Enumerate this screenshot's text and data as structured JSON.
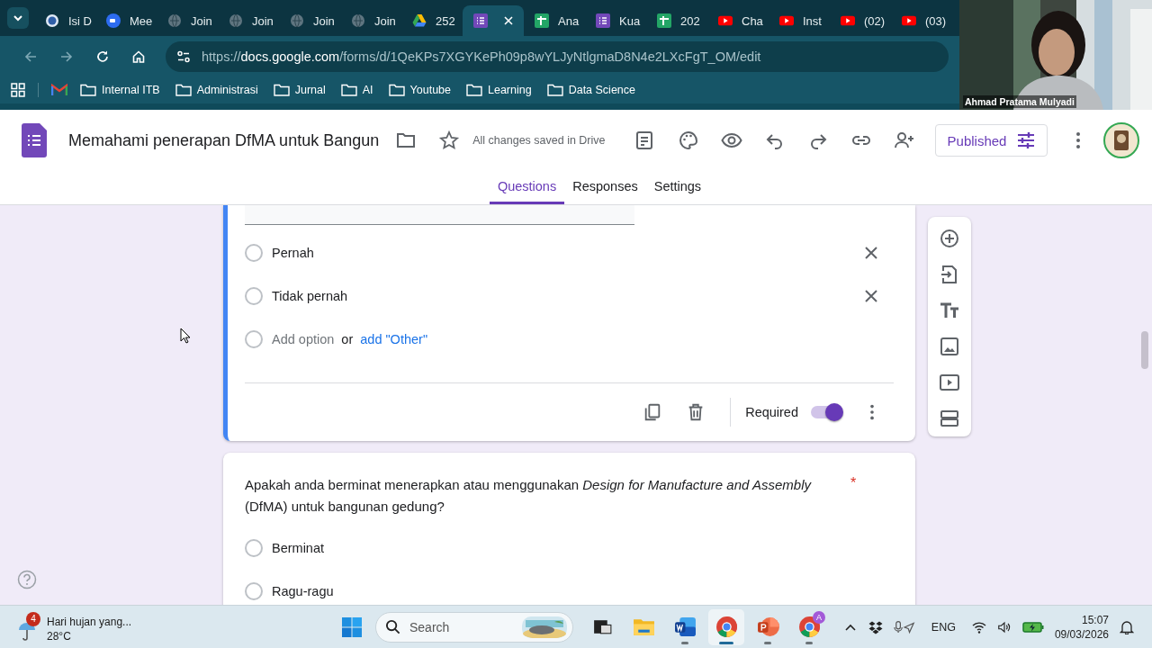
{
  "browser": {
    "tabs": [
      {
        "title": "Isi D",
        "kind": "portal",
        "selected": false
      },
      {
        "title": "Mee",
        "kind": "zoom",
        "selected": false
      },
      {
        "title": "Join",
        "kind": "site",
        "selected": false
      },
      {
        "title": "Join",
        "kind": "site",
        "selected": false
      },
      {
        "title": "Join",
        "kind": "site",
        "selected": false
      },
      {
        "title": "Join",
        "kind": "site",
        "selected": false
      },
      {
        "title": "252",
        "kind": "drive",
        "selected": false
      },
      {
        "kind": "forms",
        "selected": true
      },
      {
        "title": "Ana",
        "kind": "sheets",
        "selected": false
      },
      {
        "title": "Kua",
        "kind": "forms",
        "selected": false
      },
      {
        "title": "202",
        "kind": "sheets",
        "selected": false
      },
      {
        "title": "Cha",
        "kind": "youtube",
        "selected": false
      },
      {
        "title": "Inst",
        "kind": "youtube",
        "selected": false
      },
      {
        "title": "(02)",
        "kind": "youtube",
        "selected": false
      },
      {
        "title": "(03)",
        "kind": "youtube",
        "selected": false
      }
    ],
    "url_scheme": "https://",
    "url_host": "docs.google.com",
    "url_path": "/forms/d/1QeKPs7XGYKePh09p8wYLJyNtlgmaD8N4e2LXcFgT_OM/edit",
    "bookmarks": [
      "Internal ITB",
      "Administrasi",
      "Jurnal",
      "AI",
      "Youtube",
      "Learning",
      "Data Science"
    ]
  },
  "video": {
    "participant_name": "Ahmad Pratama Mulyadi"
  },
  "form_header": {
    "title": "Memahami penerapan DfMA untuk Bangun",
    "save_status": "All changes saved in Drive",
    "publish_button": "Published",
    "tabs": [
      {
        "label": "Questions",
        "selected": true
      },
      {
        "label": "Responses",
        "selected": false
      },
      {
        "label": "Settings",
        "selected": false
      }
    ]
  },
  "questions": [
    {
      "options": [
        {
          "label": "Pernah",
          "selected": false
        },
        {
          "label": "Tidak pernah",
          "selected": false
        }
      ],
      "add_option": "Add option",
      "or": "or",
      "add_other": "add \"Other\"",
      "required_label": "Required",
      "required": true
    },
    {
      "text": "Apakah anda berminat menerapkan atau menggunakan *Design for Manufacture and Assembly* (DfMA) untuk bangunan gedung?",
      "required_mark": "*",
      "options": [
        {
          "label": "Berminat",
          "selected": false
        },
        {
          "label": "Ragu-ragu",
          "selected": false
        }
      ]
    }
  ],
  "taskbar": {
    "weather_badge": "4",
    "weather_summary": "Hari hujan yang...",
    "weather_temp": "28°C",
    "search_placeholder": "Search",
    "apps": [
      {
        "kind": "task-view",
        "selected": false,
        "running": false
      },
      {
        "kind": "folder",
        "selected": false,
        "running": false
      },
      {
        "kind": "word",
        "selected": false,
        "running": true
      },
      {
        "kind": "chrome",
        "selected": true,
        "running": true
      },
      {
        "kind": "powerpoint",
        "selected": false,
        "running": true
      },
      {
        "kind": "chrome-profile",
        "badge": "A",
        "selected": false,
        "running": true
      }
    ],
    "language": "ENG",
    "time": "15:07",
    "date": "09/03/2026"
  }
}
